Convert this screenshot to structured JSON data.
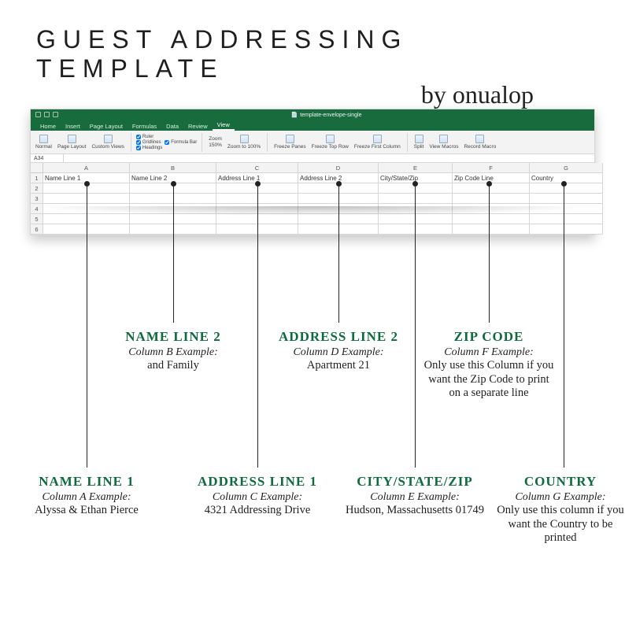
{
  "header": {
    "title": "GUEST ADDRESSING TEMPLATE",
    "byline": "by onualop"
  },
  "excel": {
    "doc": "template-envelope-single",
    "tabs": [
      "Home",
      "Insert",
      "Page Layout",
      "Formulas",
      "Data",
      "Review",
      "View"
    ],
    "active_tab": "View",
    "ribbon": {
      "views": [
        "Normal",
        "Page Layout",
        "Custom Views"
      ],
      "checks1": [
        "Ruler",
        "Gridlines",
        "Headings"
      ],
      "checks2": [
        "Formula Bar"
      ],
      "zoom_label": "Zoom",
      "zoom_value": "150%",
      "zoom_100": "Zoom to 100%",
      "freeze": [
        "Freeze Panes",
        "Freeze Top Row",
        "Freeze First Column"
      ],
      "right": [
        "Split",
        "View Macros",
        "Record Macro"
      ]
    },
    "name_box": "A34",
    "col_letters": [
      "A",
      "B",
      "C",
      "D",
      "E",
      "F",
      "G"
    ],
    "row1": [
      "Name Line 1",
      "Name Line 2",
      "Address Line 1",
      "Address Line 2",
      "City/State/Zip",
      "Zip Code Line",
      "Country"
    ]
  },
  "callouts": {
    "short": [
      {
        "label": "NAME LINE 2",
        "sub": "Column B Example:",
        "ex": "and Family"
      },
      {
        "label": "ADDRESS LINE 2",
        "sub": "Column D Example:",
        "ex": "Apartment 21"
      },
      {
        "label": "ZIP CODE",
        "sub": "Column F Example:",
        "ex": "Only use this Column if you want the Zip Code to print on a separate line"
      }
    ],
    "long": [
      {
        "label": "NAME LINE 1",
        "sub": "Column A Example:",
        "ex": "Alyssa & Ethan Pierce"
      },
      {
        "label": "ADDRESS LINE 1",
        "sub": "Column C Example:",
        "ex": "4321 Addressing Drive"
      },
      {
        "label": "CITY/STATE/ZIP",
        "sub": "Column E Example:",
        "ex": "Hudson, Massachusetts 01749"
      },
      {
        "label": "COUNTRY",
        "sub": "Column G Example:",
        "ex": "Only use this column if you want the Country to be printed"
      }
    ]
  }
}
